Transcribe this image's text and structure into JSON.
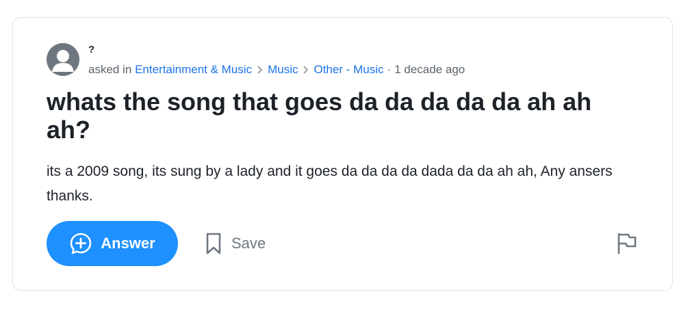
{
  "question": {
    "asker": "?",
    "asked_in_prefix": "asked in",
    "breadcrumbs": [
      "Entertainment & Music",
      "Music",
      "Other - Music"
    ],
    "time_ago": "1 decade ago",
    "title": "whats the song that goes da da da da da ah ah ah?",
    "body": "its a 2009 song, its sung by a lady and it goes da da da da dada da da ah ah, Any ansers thanks."
  },
  "actions": {
    "answer_label": "Answer",
    "save_label": "Save"
  },
  "icons": {
    "avatar": "user-avatar-icon",
    "answer": "plus-speech-bubble-icon",
    "save": "bookmark-icon",
    "report": "flag-icon",
    "breadcrumb_separator": "chevron-right-icon"
  },
  "colors": {
    "link": "#1a73e8",
    "answer_button": "#1e90ff",
    "muted": "#6e7780",
    "card_border": "#e0e4e9"
  }
}
